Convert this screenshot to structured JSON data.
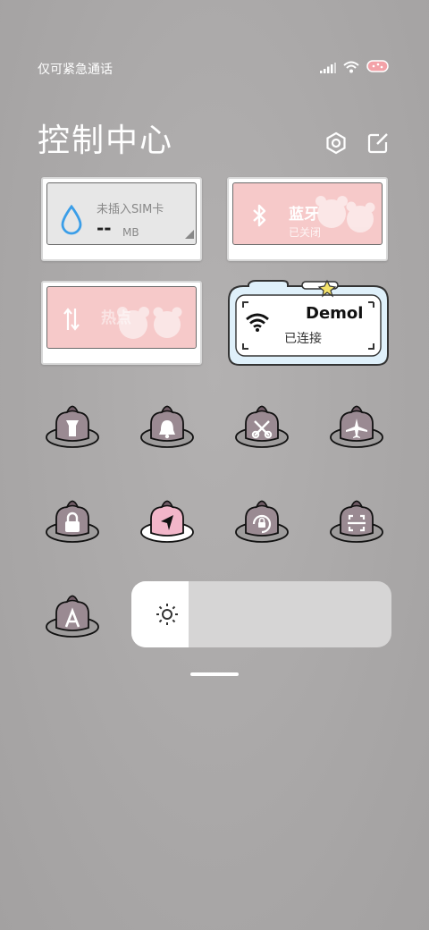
{
  "status_bar": {
    "carrier_text": "仅可紧急通话",
    "icons": [
      "signal-icon",
      "wifi-icon",
      "battery-icon"
    ]
  },
  "header": {
    "title": "控制中心",
    "settings_icon": "settings-icon",
    "edit_icon": "edit-icon"
  },
  "cards": {
    "mobile_data": {
      "status": "未插入SIM卡",
      "value": "--",
      "unit": "MB"
    },
    "bluetooth": {
      "label": "蓝牙",
      "status": "已关闭"
    },
    "hotspot": {
      "label": "热点"
    },
    "wifi": {
      "network": "Demol",
      "status": "已连接"
    }
  },
  "toggles": [
    {
      "name": "flashlight",
      "icon": "flashlight-icon",
      "active": false
    },
    {
      "name": "bell",
      "icon": "bell-icon",
      "active": false
    },
    {
      "name": "screenshot",
      "icon": "scissors-icon",
      "active": false
    },
    {
      "name": "airplane",
      "icon": "airplane-icon",
      "active": false
    },
    {
      "name": "lock",
      "icon": "lock-icon",
      "active": false
    },
    {
      "name": "location",
      "icon": "location-icon",
      "active": true
    },
    {
      "name": "rotation-lock",
      "icon": "rotation-lock-icon",
      "active": false
    },
    {
      "name": "scanner",
      "icon": "scan-icon",
      "active": false
    },
    {
      "name": "auto-brightness",
      "icon": "auto-brightness-icon",
      "active": false
    }
  ],
  "brightness": {
    "icon": "brightness-icon",
    "level": 0.22
  },
  "colors": {
    "pink": "#f6c9c9",
    "toggle_body": "#9a8a92",
    "active_body": "#f2b6c9",
    "card_border": "#6b6b6b"
  }
}
